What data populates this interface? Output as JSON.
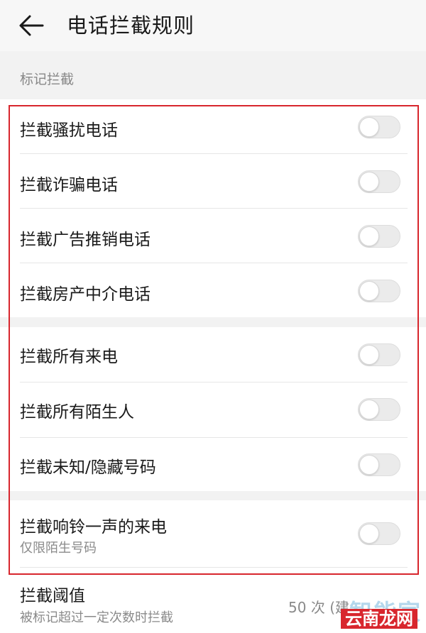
{
  "header": {
    "title": "电话拦截规则",
    "back_icon": "arrow-left-icon"
  },
  "section": {
    "label": "标记拦截"
  },
  "rules": [
    {
      "label": "拦截骚扰电话",
      "enabled": false
    },
    {
      "label": "拦截诈骗电话",
      "enabled": false
    },
    {
      "label": "拦截广告推销电话",
      "enabled": false
    },
    {
      "label": "拦截房产中介电话",
      "enabled": false
    },
    {
      "label": "拦截所有来电",
      "enabled": false
    },
    {
      "label": "拦截所有陌生人",
      "enabled": false
    },
    {
      "label": "拦截未知/隐藏号码",
      "enabled": false
    },
    {
      "label": "拦截响铃一声的来电",
      "sublabel": "仅限陌生号码",
      "enabled": false
    }
  ],
  "threshold": {
    "label": "拦截阈值",
    "sublabel": "被标记超过一定次数时拦截",
    "value": "50 次 (建"
  },
  "watermark": {
    "back_text": "智能家",
    "front_text": "云南龙网"
  },
  "colors": {
    "highlight": "#d8262d",
    "switch_off": "#ebebeb"
  }
}
